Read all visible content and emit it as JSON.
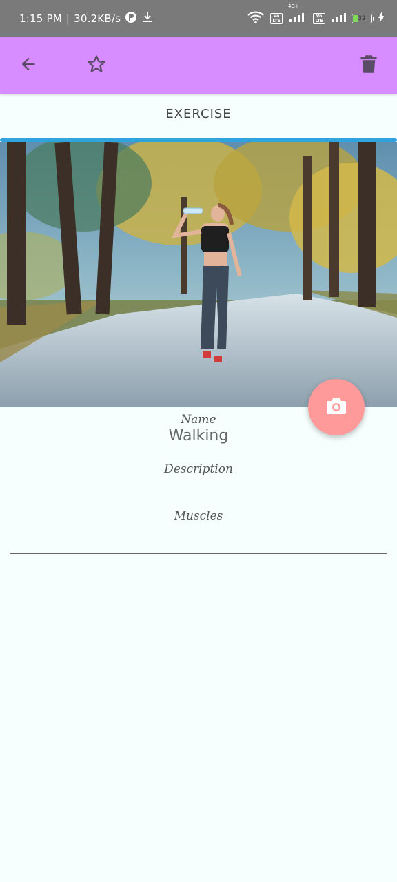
{
  "status_bar": {
    "time": "1:15 PM",
    "net_speed": "30.2KB/s",
    "net_label": "4G+",
    "volte_label": "Vo LTE",
    "battery_level": "32",
    "battery_fraction": 0.32
  },
  "app_bar": {
    "color": "#d78cff",
    "icons": [
      "arrow-back-icon",
      "star-outline-icon",
      "trash-icon"
    ]
  },
  "page": {
    "section_title": "EXERCISE"
  },
  "fields": {
    "name_label": "Name",
    "name_value": "Walking",
    "description_label": "Description",
    "muscles_label": "Muscles"
  },
  "fab": {
    "icon": "camera-icon",
    "color": "#ff9a9a"
  }
}
